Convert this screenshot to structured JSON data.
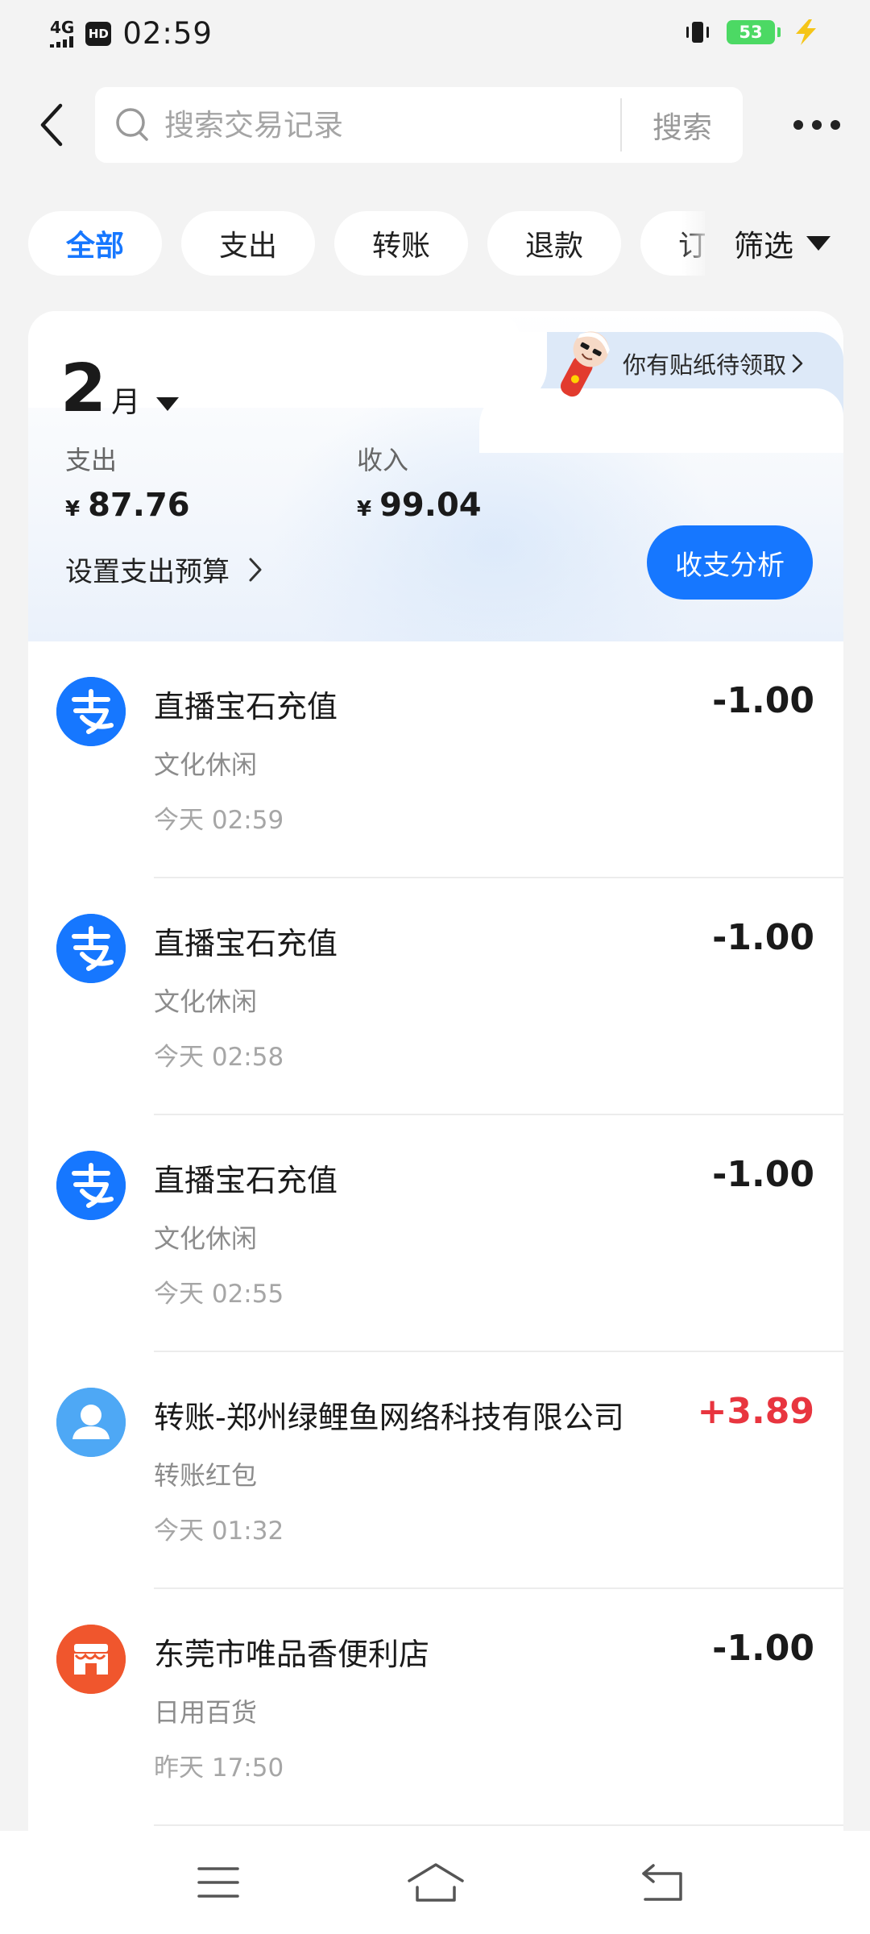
{
  "status_bar": {
    "network": "4G",
    "hd": "HD",
    "time": "02:59",
    "battery": "53"
  },
  "header": {
    "search_placeholder": "搜索交易记录",
    "search_button": "搜索"
  },
  "filters": {
    "chips": [
      "全部",
      "支出",
      "转账",
      "退款",
      "订单"
    ],
    "filter_label": "筛选"
  },
  "summary": {
    "sticker_text": "你有贴纸待领取",
    "month": "2",
    "month_unit": "月",
    "expense_label": "支出",
    "expense_currency": "¥",
    "expense_value": "87.76",
    "income_label": "收入",
    "income_currency": "¥",
    "income_value": "99.04",
    "budget_label": "设置支出预算",
    "analysis_button": "收支分析"
  },
  "transactions": [
    {
      "title": "直播宝石充值",
      "category": "文化休闲",
      "time": "今天 02:59",
      "amount": "-1.00",
      "icon": "alipay-icon"
    },
    {
      "title": "直播宝石充值",
      "category": "文化休闲",
      "time": "今天 02:58",
      "amount": "-1.00",
      "icon": "alipay-icon"
    },
    {
      "title": "直播宝石充值",
      "category": "文化休闲",
      "time": "今天 02:55",
      "amount": "-1.00",
      "icon": "alipay-icon"
    },
    {
      "title": "转账-郑州绿鲤鱼网络科技有限公司",
      "category": "转账红包",
      "time": "今天 01:32",
      "amount": "+3.89",
      "icon": "person-icon"
    },
    {
      "title": "东莞市唯品香便利店",
      "category": "日用百货",
      "time": "昨天 17:50",
      "amount": "-1.00",
      "icon": "store-icon"
    }
  ],
  "colors": {
    "accent": "#1677ff",
    "income": "#e8353f",
    "alipay": "#1677ff",
    "person": "#4ea8f5",
    "store": "#f0562d"
  }
}
